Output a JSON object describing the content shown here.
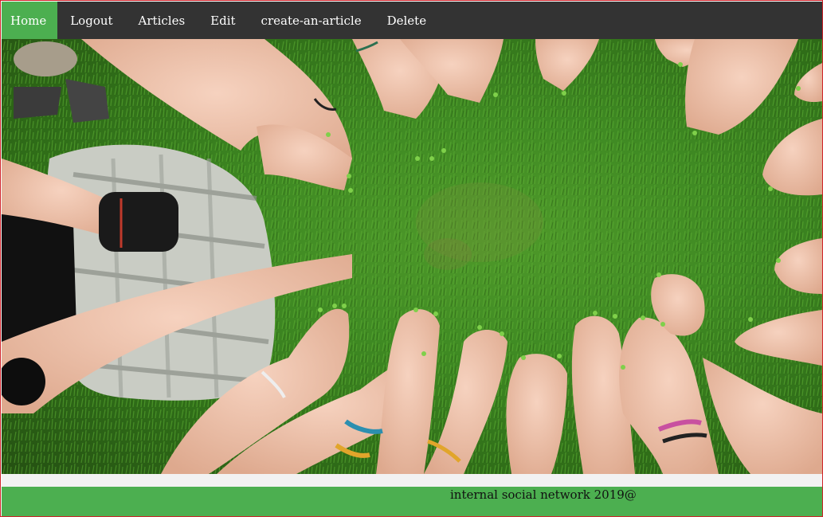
{
  "nav": {
    "items": [
      {
        "label": "Home",
        "active": true
      },
      {
        "label": "Logout",
        "active": false
      },
      {
        "label": "Articles",
        "active": false
      },
      {
        "label": "Edit",
        "active": false
      },
      {
        "label": "create-an-article",
        "active": false
      },
      {
        "label": "Delete",
        "active": false
      }
    ]
  },
  "footer": {
    "text": "internal social network 2019@"
  },
  "colors": {
    "navbar_bg": "#333333",
    "active_bg": "#4caf50",
    "footer_bg": "#4caf50",
    "frame_border": "#d0242b"
  }
}
